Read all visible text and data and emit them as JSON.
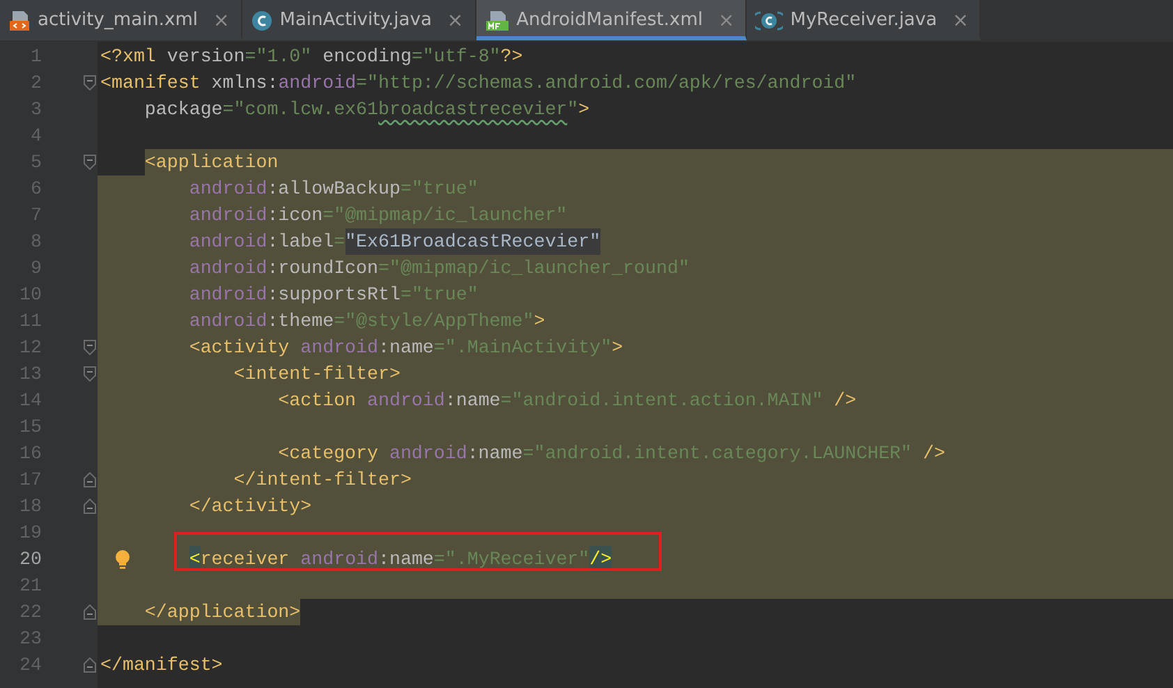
{
  "tabs": [
    {
      "label": "activity_main.xml",
      "kind": "xml",
      "selected": false,
      "close": "×"
    },
    {
      "label": "MainActivity.java",
      "kind": "class",
      "selected": false,
      "close": "×"
    },
    {
      "label": "AndroidManifest.xml",
      "kind": "manifest",
      "selected": true,
      "close": "×"
    },
    {
      "label": "MyReceiver.java",
      "kind": "class-bracket",
      "selected": false,
      "close": "×"
    }
  ],
  "editor": {
    "lines": [
      {
        "number": "1",
        "kind": "plain",
        "selected": false,
        "current": false,
        "boxed": false,
        "bulb": false,
        "tokens": [
          {
            "kind": "tag",
            "text": "<?xml "
          },
          {
            "kind": "attr",
            "text": "version"
          },
          {
            "kind": "value",
            "text": "=\"1.0\" "
          },
          {
            "kind": "attr",
            "text": "encoding"
          },
          {
            "kind": "value",
            "text": "=\"utf-8\""
          },
          {
            "kind": "tag",
            "text": "?>"
          }
        ]
      },
      {
        "number": "2",
        "kind": "fold-start",
        "selected": false,
        "current": false,
        "boxed": false,
        "bulb": false,
        "tokens": [
          {
            "kind": "tag",
            "text": "<manifest "
          },
          {
            "kind": "attr",
            "text": "xmlns:"
          },
          {
            "kind": "ns",
            "text": "android"
          },
          {
            "kind": "value",
            "text": "=\"http://schemas.android.com/apk/res/android\""
          }
        ]
      },
      {
        "number": "3",
        "kind": "plain",
        "selected": false,
        "current": false,
        "boxed": false,
        "bulb": false,
        "tokens": [
          {
            "kind": "attr",
            "text": "    package"
          },
          {
            "kind": "value",
            "text": "=\"com.lcw.ex61"
          },
          {
            "kind": "typo",
            "text": "broadcastrecevier"
          },
          {
            "kind": "value",
            "text": "\""
          },
          {
            "kind": "tag",
            "text": ">"
          }
        ]
      },
      {
        "number": "4",
        "kind": "plain",
        "selected": false,
        "current": false,
        "boxed": false,
        "bulb": false
      },
      {
        "number": "5",
        "kind": "fold-start",
        "selected": true,
        "current": false,
        "boxed": false,
        "bulb": false,
        "tokens": [
          {
            "kind": "tag",
            "text": "    <application"
          }
        ]
      },
      {
        "number": "6",
        "kind": "plain",
        "selected": true,
        "current": false,
        "boxed": false,
        "bulb": false,
        "tokens": [
          {
            "kind": "ns",
            "text": "        android"
          },
          {
            "kind": "attr",
            "text": ":allowBackup"
          },
          {
            "kind": "value",
            "text": "=\"true\""
          }
        ]
      },
      {
        "number": "7",
        "kind": "plain",
        "selected": true,
        "current": false,
        "boxed": false,
        "bulb": false,
        "tokens": [
          {
            "kind": "ns",
            "text": "        android"
          },
          {
            "kind": "attr",
            "text": ":icon"
          },
          {
            "kind": "value",
            "text": "=\"@mipmap/ic_launcher\""
          }
        ]
      },
      {
        "number": "8",
        "kind": "plain",
        "selected": true,
        "current": false,
        "boxed": false,
        "bulb": false,
        "tokens": [
          {
            "kind": "ns",
            "text": "        android"
          },
          {
            "kind": "attr",
            "text": ":label"
          },
          {
            "kind": "value",
            "text": "="
          },
          {
            "kind": "match",
            "text": "\"Ex61BroadcastRecevier\""
          }
        ]
      },
      {
        "number": "9",
        "kind": "plain",
        "selected": true,
        "current": false,
        "boxed": false,
        "bulb": false,
        "tokens": [
          {
            "kind": "ns",
            "text": "        android"
          },
          {
            "kind": "attr",
            "text": ":roundIcon"
          },
          {
            "kind": "value",
            "text": "=\"@mipmap/ic_launcher_round\""
          }
        ]
      },
      {
        "number": "10",
        "kind": "plain",
        "selected": true,
        "current": false,
        "boxed": false,
        "bulb": false,
        "tokens": [
          {
            "kind": "ns",
            "text": "        android"
          },
          {
            "kind": "attr",
            "text": ":supportsRtl"
          },
          {
            "kind": "value",
            "text": "=\"true\""
          }
        ]
      },
      {
        "number": "11",
        "kind": "plain",
        "selected": true,
        "current": false,
        "boxed": false,
        "bulb": false,
        "tokens": [
          {
            "kind": "ns",
            "text": "        android"
          },
          {
            "kind": "attr",
            "text": ":theme"
          },
          {
            "kind": "value",
            "text": "=\"@style/AppTheme\""
          },
          {
            "kind": "tag",
            "text": ">"
          }
        ]
      },
      {
        "number": "12",
        "kind": "fold-start",
        "selected": true,
        "current": false,
        "boxed": false,
        "bulb": false,
        "tokens": [
          {
            "kind": "tag",
            "text": "        <activity "
          },
          {
            "kind": "ns",
            "text": "android"
          },
          {
            "kind": "attr",
            "text": ":name"
          },
          {
            "kind": "value",
            "text": "=\".MainActivity\""
          },
          {
            "kind": "tag",
            "text": ">"
          }
        ]
      },
      {
        "number": "13",
        "kind": "fold-start",
        "selected": true,
        "current": false,
        "boxed": false,
        "bulb": false,
        "tokens": [
          {
            "kind": "tag",
            "text": "            <intent-filter>"
          }
        ]
      },
      {
        "number": "14",
        "kind": "plain",
        "selected": true,
        "current": false,
        "boxed": false,
        "bulb": false,
        "tokens": [
          {
            "kind": "tag",
            "text": "                <action "
          },
          {
            "kind": "ns",
            "text": "android"
          },
          {
            "kind": "attr",
            "text": ":name"
          },
          {
            "kind": "value",
            "text": "=\"android.intent.action.MAIN\" "
          },
          {
            "kind": "tag",
            "text": "/>"
          }
        ]
      },
      {
        "number": "15",
        "kind": "plain",
        "selected": true,
        "current": false,
        "boxed": false,
        "bulb": false
      },
      {
        "number": "16",
        "kind": "plain",
        "selected": true,
        "current": false,
        "boxed": false,
        "bulb": false,
        "tokens": [
          {
            "kind": "tag",
            "text": "                <category "
          },
          {
            "kind": "ns",
            "text": "android"
          },
          {
            "kind": "attr",
            "text": ":name"
          },
          {
            "kind": "value",
            "text": "=\"android.intent.category.LAUNCHER\" "
          },
          {
            "kind": "tag",
            "text": "/>"
          }
        ]
      },
      {
        "number": "17",
        "kind": "fold-end",
        "selected": true,
        "current": false,
        "boxed": false,
        "bulb": false,
        "tokens": [
          {
            "kind": "tag",
            "text": "            </intent-filter>"
          }
        ]
      },
      {
        "number": "18",
        "kind": "fold-end",
        "selected": true,
        "current": false,
        "boxed": false,
        "bulb": false,
        "tokens": [
          {
            "kind": "tag",
            "text": "        </activity>"
          }
        ]
      },
      {
        "number": "19",
        "kind": "plain",
        "selected": true,
        "current": false,
        "boxed": false,
        "bulb": false
      },
      {
        "number": "20",
        "kind": "plain",
        "selected": true,
        "current": true,
        "boxed": true,
        "bulb": true,
        "tokens": [
          {
            "kind": "brace",
            "text": "        <"
          },
          {
            "kind": "tag",
            "text": "receiver "
          },
          {
            "kind": "ns",
            "text": "android"
          },
          {
            "kind": "attr",
            "text": ":name"
          },
          {
            "kind": "value",
            "text": "=\".MyReceiver\""
          },
          {
            "kind": "brace",
            "text": "/>"
          }
        ]
      },
      {
        "number": "21",
        "kind": "plain",
        "selected": true,
        "current": false,
        "boxed": false,
        "bulb": false
      },
      {
        "number": "22",
        "kind": "fold-end",
        "selected": true,
        "current": false,
        "boxed": false,
        "bulb": false,
        "tokens": [
          {
            "kind": "tag",
            "text": "    </application>"
          }
        ]
      },
      {
        "number": "23",
        "kind": "plain",
        "selected": false,
        "current": false,
        "boxed": false,
        "bulb": false
      },
      {
        "number": "24",
        "kind": "fold-end",
        "selected": false,
        "current": false,
        "boxed": false,
        "bulb": false,
        "tokens": [
          {
            "kind": "tag",
            "text": "</manifest>"
          }
        ]
      }
    ]
  }
}
